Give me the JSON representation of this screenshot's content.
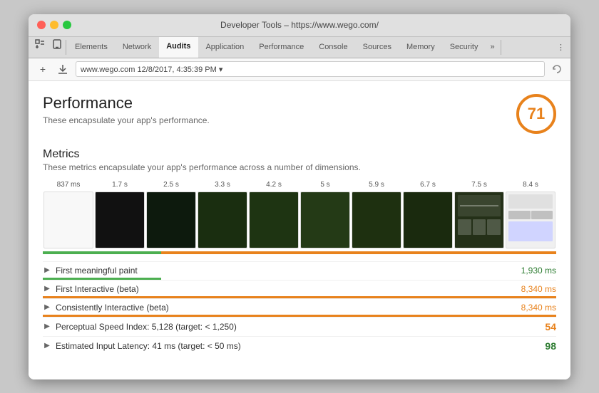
{
  "window": {
    "title": "Developer Tools – https://www.wego.com/"
  },
  "traffic_lights": {
    "red": "close",
    "yellow": "minimize",
    "green": "maximize"
  },
  "tabs": [
    {
      "id": "elements",
      "label": "Elements",
      "active": false
    },
    {
      "id": "network",
      "label": "Network",
      "active": false
    },
    {
      "id": "audits",
      "label": "Audits",
      "active": true
    },
    {
      "id": "application",
      "label": "Application",
      "active": false
    },
    {
      "id": "performance",
      "label": "Performance",
      "active": false
    },
    {
      "id": "console",
      "label": "Console",
      "active": false
    },
    {
      "id": "sources",
      "label": "Sources",
      "active": false
    },
    {
      "id": "memory",
      "label": "Memory",
      "active": false
    },
    {
      "id": "security",
      "label": "Security",
      "active": false
    }
  ],
  "address_bar": {
    "value": "www.wego.com  12/8/2017, 4:35:39 PM ▾"
  },
  "main": {
    "section_title": "Performance",
    "section_subtitle": "These encapsulate your app's performance.",
    "score": "71",
    "metrics": {
      "title": "Metrics",
      "subtitle": "These metrics encapsulate your app's performance across a number of dimensions.",
      "filmstrip": [
        {
          "time": "837 ms",
          "style": "black"
        },
        {
          "time": "1.7 s",
          "style": "black"
        },
        {
          "time": "2.5 s",
          "style": "dark"
        },
        {
          "time": "3.3 s",
          "style": "dark"
        },
        {
          "time": "4.2 s",
          "style": "partial"
        },
        {
          "time": "5 s",
          "style": "partial"
        },
        {
          "time": "5.9 s",
          "style": "loaded"
        },
        {
          "time": "6.7 s",
          "style": "loaded"
        },
        {
          "time": "7.5 s",
          "style": "ui"
        },
        {
          "time": "8.4 s",
          "style": "ui"
        }
      ]
    },
    "metric_rows": [
      {
        "id": "fmp",
        "label": "First meaningful paint",
        "value": "1,930 ms",
        "value_color": "green",
        "has_bar": true,
        "bar_color": "green",
        "bar_width": "23"
      },
      {
        "id": "fi",
        "label": "First Interactive (beta)",
        "value": "8,340 ms",
        "value_color": "orange",
        "has_bar": true,
        "bar_color": "orange",
        "bar_width": "100"
      },
      {
        "id": "ci",
        "label": "Consistently Interactive (beta)",
        "value": "8,340 ms",
        "value_color": "orange",
        "has_bar": true,
        "bar_color": "orange",
        "bar_width": "100"
      },
      {
        "id": "psi",
        "label": "Perceptual Speed Index: 5,128 (target: < 1,250)",
        "value": "",
        "score": "54",
        "score_color": "orange",
        "has_bar": false
      },
      {
        "id": "eil",
        "label": "Estimated Input Latency: 41 ms (target: < 50 ms)",
        "value": "",
        "score": "98",
        "score_color": "green",
        "has_bar": false
      }
    ]
  }
}
